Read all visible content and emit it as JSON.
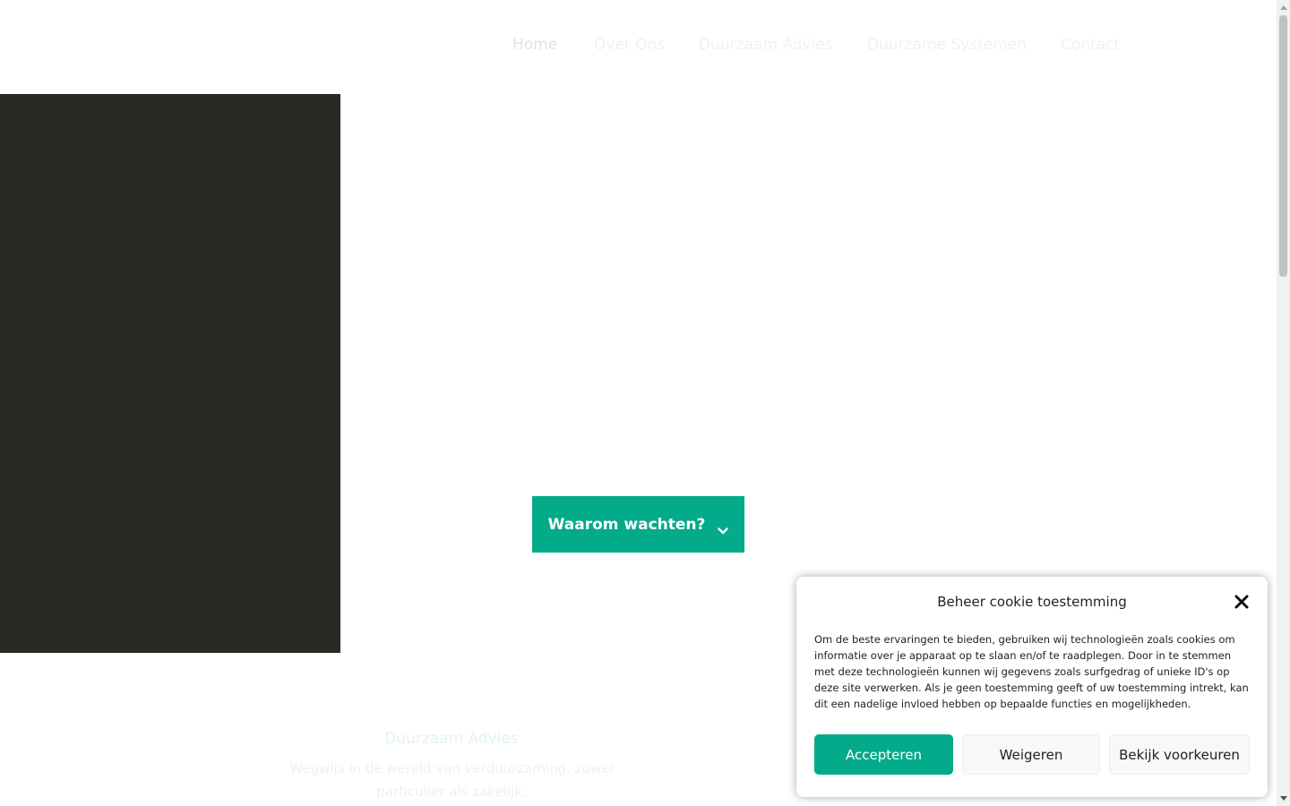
{
  "nav": {
    "items": [
      {
        "label": "Home",
        "active": true
      },
      {
        "label": "Over Ons"
      },
      {
        "label": "Duurzaam Advies"
      },
      {
        "label": "Duurzame Systemen"
      },
      {
        "label": "Contact"
      }
    ]
  },
  "hero": {
    "cta_label": "Waarom wachten?",
    "cta_icon": "chevron-down-icon"
  },
  "section": {
    "title": "Duurzaam Advies",
    "text": "Wegwijs in de wereld van verduurzaming, zowel particulier als zakelijk."
  },
  "cookie": {
    "title": "Beheer cookie toestemming",
    "text": "Om de beste ervaringen te bieden, gebruiken wij technologieën zoals cookies om informatie over je apparaat op te slaan en/of te raadplegen. Door in te stemmen met deze technologieën kunnen wij gegevens zoals surfgedrag of unieke ID's op deze site verwerken. Als je geen toestemming geeft of uw toestemming intrekt, kan dit een nadelige invloed hebben op bepaalde functies en mogelijkheden.",
    "accept_label": "Accepteren",
    "deny_label": "Weigeren",
    "prefs_label": "Bekijk voorkeuren",
    "close_icon": "close-icon"
  },
  "colors": {
    "accent": "#04ab8a",
    "hero_dark": "#2a2924"
  }
}
